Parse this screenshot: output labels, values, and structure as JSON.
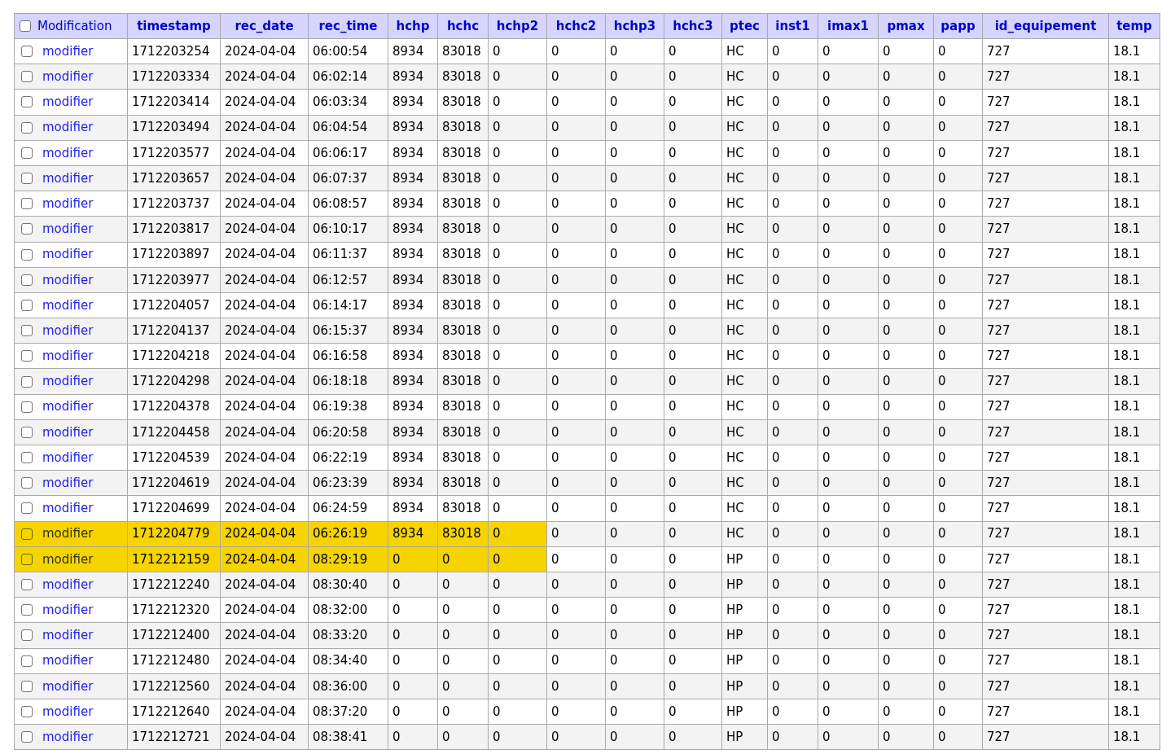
{
  "table": {
    "header_checked": false,
    "columns": [
      "Modification",
      "timestamp",
      "rec_date",
      "rec_time",
      "hchp",
      "hchc",
      "hchp2",
      "hchc2",
      "hchp3",
      "hchc3",
      "ptec",
      "inst1",
      "imax1",
      "pmax",
      "papp",
      "id_equipement",
      "temp"
    ],
    "rows": [
      {
        "checked": false,
        "highlighted": false,
        "cells": [
          "modifier",
          "1712203254",
          "2024-04-04",
          "06:00:54",
          "8934",
          "83018",
          "0",
          "0",
          "0",
          "0",
          "HC",
          "0",
          "0",
          "0",
          "0",
          "727",
          "18.1"
        ]
      },
      {
        "checked": false,
        "highlighted": false,
        "cells": [
          "modifier",
          "1712203334",
          "2024-04-04",
          "06:02:14",
          "8934",
          "83018",
          "0",
          "0",
          "0",
          "0",
          "HC",
          "0",
          "0",
          "0",
          "0",
          "727",
          "18.1"
        ]
      },
      {
        "checked": false,
        "highlighted": false,
        "cells": [
          "modifier",
          "1712203414",
          "2024-04-04",
          "06:03:34",
          "8934",
          "83018",
          "0",
          "0",
          "0",
          "0",
          "HC",
          "0",
          "0",
          "0",
          "0",
          "727",
          "18.1"
        ]
      },
      {
        "checked": false,
        "highlighted": false,
        "cells": [
          "modifier",
          "1712203494",
          "2024-04-04",
          "06:04:54",
          "8934",
          "83018",
          "0",
          "0",
          "0",
          "0",
          "HC",
          "0",
          "0",
          "0",
          "0",
          "727",
          "18.1"
        ]
      },
      {
        "checked": false,
        "highlighted": false,
        "cells": [
          "modifier",
          "1712203577",
          "2024-04-04",
          "06:06:17",
          "8934",
          "83018",
          "0",
          "0",
          "0",
          "0",
          "HC",
          "0",
          "0",
          "0",
          "0",
          "727",
          "18.1"
        ]
      },
      {
        "checked": false,
        "highlighted": false,
        "cells": [
          "modifier",
          "1712203657",
          "2024-04-04",
          "06:07:37",
          "8934",
          "83018",
          "0",
          "0",
          "0",
          "0",
          "HC",
          "0",
          "0",
          "0",
          "0",
          "727",
          "18.1"
        ]
      },
      {
        "checked": false,
        "highlighted": false,
        "cells": [
          "modifier",
          "1712203737",
          "2024-04-04",
          "06:08:57",
          "8934",
          "83018",
          "0",
          "0",
          "0",
          "0",
          "HC",
          "0",
          "0",
          "0",
          "0",
          "727",
          "18.1"
        ]
      },
      {
        "checked": false,
        "highlighted": false,
        "cells": [
          "modifier",
          "1712203817",
          "2024-04-04",
          "06:10:17",
          "8934",
          "83018",
          "0",
          "0",
          "0",
          "0",
          "HC",
          "0",
          "0",
          "0",
          "0",
          "727",
          "18.1"
        ]
      },
      {
        "checked": false,
        "highlighted": false,
        "cells": [
          "modifier",
          "1712203897",
          "2024-04-04",
          "06:11:37",
          "8934",
          "83018",
          "0",
          "0",
          "0",
          "0",
          "HC",
          "0",
          "0",
          "0",
          "0",
          "727",
          "18.1"
        ]
      },
      {
        "checked": false,
        "highlighted": false,
        "cells": [
          "modifier",
          "1712203977",
          "2024-04-04",
          "06:12:57",
          "8934",
          "83018",
          "0",
          "0",
          "0",
          "0",
          "HC",
          "0",
          "0",
          "0",
          "0",
          "727",
          "18.1"
        ]
      },
      {
        "checked": false,
        "highlighted": false,
        "cells": [
          "modifier",
          "1712204057",
          "2024-04-04",
          "06:14:17",
          "8934",
          "83018",
          "0",
          "0",
          "0",
          "0",
          "HC",
          "0",
          "0",
          "0",
          "0",
          "727",
          "18.1"
        ]
      },
      {
        "checked": false,
        "highlighted": false,
        "cells": [
          "modifier",
          "1712204137",
          "2024-04-04",
          "06:15:37",
          "8934",
          "83018",
          "0",
          "0",
          "0",
          "0",
          "HC",
          "0",
          "0",
          "0",
          "0",
          "727",
          "18.1"
        ]
      },
      {
        "checked": false,
        "highlighted": false,
        "cells": [
          "modifier",
          "1712204218",
          "2024-04-04",
          "06:16:58",
          "8934",
          "83018",
          "0",
          "0",
          "0",
          "0",
          "HC",
          "0",
          "0",
          "0",
          "0",
          "727",
          "18.1"
        ]
      },
      {
        "checked": false,
        "highlighted": false,
        "cells": [
          "modifier",
          "1712204298",
          "2024-04-04",
          "06:18:18",
          "8934",
          "83018",
          "0",
          "0",
          "0",
          "0",
          "HC",
          "0",
          "0",
          "0",
          "0",
          "727",
          "18.1"
        ]
      },
      {
        "checked": false,
        "highlighted": false,
        "cells": [
          "modifier",
          "1712204378",
          "2024-04-04",
          "06:19:38",
          "8934",
          "83018",
          "0",
          "0",
          "0",
          "0",
          "HC",
          "0",
          "0",
          "0",
          "0",
          "727",
          "18.1"
        ]
      },
      {
        "checked": false,
        "highlighted": false,
        "cells": [
          "modifier",
          "1712204458",
          "2024-04-04",
          "06:20:58",
          "8934",
          "83018",
          "0",
          "0",
          "0",
          "0",
          "HC",
          "0",
          "0",
          "0",
          "0",
          "727",
          "18.1"
        ]
      },
      {
        "checked": false,
        "highlighted": false,
        "cells": [
          "modifier",
          "1712204539",
          "2024-04-04",
          "06:22:19",
          "8934",
          "83018",
          "0",
          "0",
          "0",
          "0",
          "HC",
          "0",
          "0",
          "0",
          "0",
          "727",
          "18.1"
        ]
      },
      {
        "checked": false,
        "highlighted": false,
        "cells": [
          "modifier",
          "1712204619",
          "2024-04-04",
          "06:23:39",
          "8934",
          "83018",
          "0",
          "0",
          "0",
          "0",
          "HC",
          "0",
          "0",
          "0",
          "0",
          "727",
          "18.1"
        ]
      },
      {
        "checked": false,
        "highlighted": false,
        "cells": [
          "modifier",
          "1712204699",
          "2024-04-04",
          "06:24:59",
          "8934",
          "83018",
          "0",
          "0",
          "0",
          "0",
          "HC",
          "0",
          "0",
          "0",
          "0",
          "727",
          "18.1"
        ]
      },
      {
        "checked": false,
        "highlighted": true,
        "cells": [
          "modifier",
          "1712204779",
          "2024-04-04",
          "06:26:19",
          "8934",
          "83018",
          "0",
          "0",
          "0",
          "0",
          "HC",
          "0",
          "0",
          "0",
          "0",
          "727",
          "18.1"
        ]
      },
      {
        "checked": false,
        "highlighted": true,
        "cells": [
          "modifier",
          "1712212159",
          "2024-04-04",
          "08:29:19",
          "0",
          "0",
          "0",
          "0",
          "0",
          "0",
          "HP",
          "0",
          "0",
          "0",
          "0",
          "727",
          "18.1"
        ]
      },
      {
        "checked": false,
        "highlighted": false,
        "cells": [
          "modifier",
          "1712212240",
          "2024-04-04",
          "08:30:40",
          "0",
          "0",
          "0",
          "0",
          "0",
          "0",
          "HP",
          "0",
          "0",
          "0",
          "0",
          "727",
          "18.1"
        ]
      },
      {
        "checked": false,
        "highlighted": false,
        "cells": [
          "modifier",
          "1712212320",
          "2024-04-04",
          "08:32:00",
          "0",
          "0",
          "0",
          "0",
          "0",
          "0",
          "HP",
          "0",
          "0",
          "0",
          "0",
          "727",
          "18.1"
        ]
      },
      {
        "checked": false,
        "highlighted": false,
        "cells": [
          "modifier",
          "1712212400",
          "2024-04-04",
          "08:33:20",
          "0",
          "0",
          "0",
          "0",
          "0",
          "0",
          "HP",
          "0",
          "0",
          "0",
          "0",
          "727",
          "18.1"
        ]
      },
      {
        "checked": false,
        "highlighted": false,
        "cells": [
          "modifier",
          "1712212480",
          "2024-04-04",
          "08:34:40",
          "0",
          "0",
          "0",
          "0",
          "0",
          "0",
          "HP",
          "0",
          "0",
          "0",
          "0",
          "727",
          "18.1"
        ]
      },
      {
        "checked": false,
        "highlighted": false,
        "cells": [
          "modifier",
          "1712212560",
          "2024-04-04",
          "08:36:00",
          "0",
          "0",
          "0",
          "0",
          "0",
          "0",
          "HP",
          "0",
          "0",
          "0",
          "0",
          "727",
          "18.1"
        ]
      },
      {
        "checked": false,
        "highlighted": false,
        "cells": [
          "modifier",
          "1712212640",
          "2024-04-04",
          "08:37:20",
          "0",
          "0",
          "0",
          "0",
          "0",
          "0",
          "HP",
          "0",
          "0",
          "0",
          "0",
          "727",
          "18.1"
        ]
      },
      {
        "checked": false,
        "highlighted": false,
        "cells": [
          "modifier",
          "1712212721",
          "2024-04-04",
          "08:38:41",
          "0",
          "0",
          "0",
          "0",
          "0",
          "0",
          "HP",
          "0",
          "0",
          "0",
          "0",
          "727",
          "18.1"
        ]
      }
    ]
  }
}
